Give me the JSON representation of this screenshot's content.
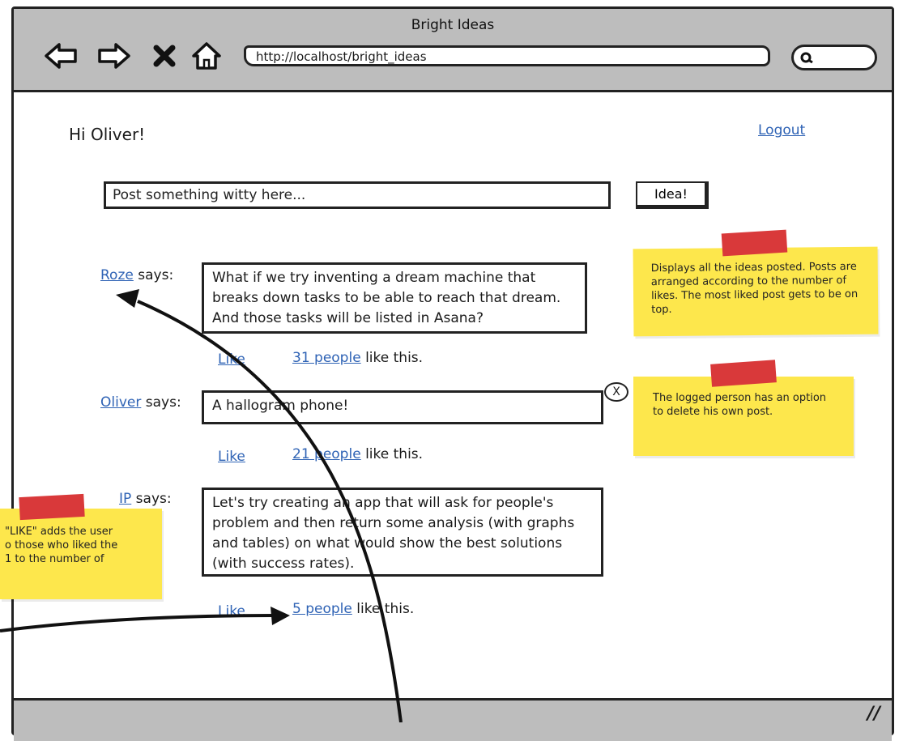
{
  "window": {
    "title": "Bright Ideas",
    "url": "http://localhost/bright_ideas",
    "nav_icons": [
      "back-arrow-icon",
      "forward-arrow-icon",
      "stop-x-icon",
      "home-icon"
    ],
    "search_icon": "magnifier-icon"
  },
  "header": {
    "greeting": "Hi Oliver!",
    "logout": "Logout"
  },
  "composer": {
    "placeholder": "Post something witty here...",
    "button": "Idea!"
  },
  "says": "says:",
  "like_label": "Like",
  "like_suffix": "like this.",
  "posts": [
    {
      "author": "Roze",
      "text": "What if we try inventing a dream machine that breaks down tasks to be able to reach that dream. And those tasks will be listed in Asana?",
      "likes": "31 people"
    },
    {
      "author": "Oliver",
      "text": "A hallogram phone!",
      "likes": "21 people",
      "delete": "X"
    },
    {
      "author": "IP",
      "text": "Let's try creating an app that will ask for people's problem and then return some analysis (with graphs and tables) on what would show the best solutions (with success rates).",
      "likes": "5 people"
    }
  ],
  "notes": {
    "display": "Displays all the ideas posted. Posts are arranged according to the number of likes. The most liked post gets to be on top.",
    "delete": "The logged person has an option to delete his own post.",
    "like": "\"LIKE\" adds the user\no those who liked the\n1 to the number of"
  },
  "colors": {
    "chrome": "#bdbdbd",
    "link": "#2f63b5",
    "note": "#fde74c",
    "tape": "#d9393a"
  }
}
